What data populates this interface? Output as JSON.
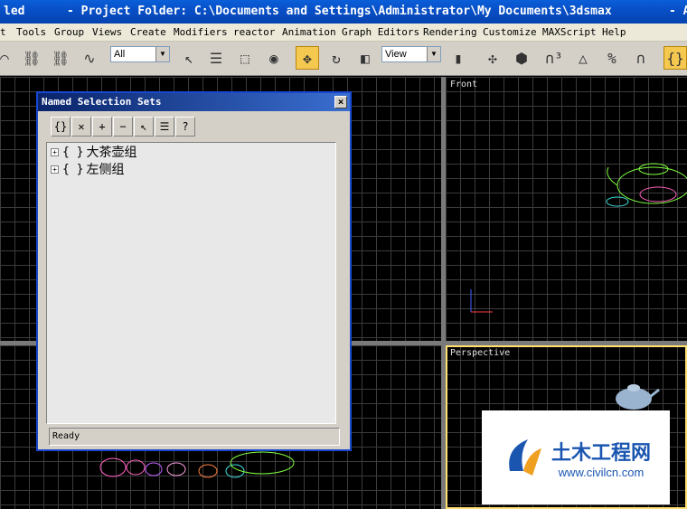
{
  "titlebar": {
    "left_fragment": "led",
    "text": "- Project Folder: C:\\Documents and Settings\\Administrator\\My Documents\\3dsmax",
    "right_fragment": "- A"
  },
  "menu": {
    "items": [
      "t",
      "Tools",
      "Group",
      "Views",
      "Create",
      "Modifiers",
      "reactor",
      "Animation",
      "Graph Editors",
      "Rendering",
      "Customize",
      "MAXScript",
      "Help"
    ]
  },
  "toolbar": {
    "filter_select": "All",
    "coord_select": "View"
  },
  "viewports": {
    "front_label": "Front",
    "perspective_label": "Perspective"
  },
  "dialog": {
    "title": "Named Selection Sets",
    "close_glyph": "×",
    "items": [
      {
        "brace": "{ }",
        "label": "大茶壶组"
      },
      {
        "brace": "{ }",
        "label": "左侧组"
      }
    ],
    "status": "Ready"
  },
  "watermark": {
    "name": "土木工程网",
    "url": "www.civilcn.com"
  },
  "colors": {
    "title_blue": "#0850c8",
    "dialog_border": "#1848d0",
    "active_viewport": "#ffe070",
    "move_active": "#f5c850",
    "watermark_blue": "#1a56b0"
  }
}
